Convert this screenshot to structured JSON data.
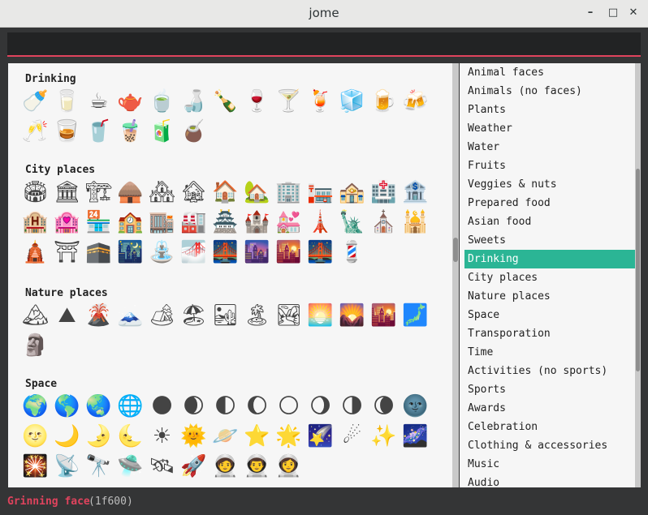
{
  "window": {
    "title": "jome",
    "minimize_glyph": "–",
    "maximize_glyph": "□",
    "close_glyph": "✕"
  },
  "search": {
    "value": ""
  },
  "sections": [
    {
      "title": "Drinking",
      "emojis": [
        "🍼",
        "🥛",
        "☕",
        "🫖",
        "🍵",
        "🍶",
        "🍾",
        "🍷",
        "🍸",
        "🍹",
        "🧊",
        "🍺",
        "🍻",
        "🥂",
        "🥃",
        "🥤",
        "🧋",
        "🧃",
        "🧉"
      ]
    },
    {
      "title": "City places",
      "emojis": [
        "🏟",
        "🏛",
        "🏗",
        "🛖",
        "🏘",
        "🏚",
        "🏠",
        "🏡",
        "🏢",
        "🏣",
        "🏤",
        "🏥",
        "🏦",
        "🏨",
        "🏩",
        "🏪",
        "🏫",
        "🏬",
        "🏭",
        "🏯",
        "🏰",
        "💒",
        "🗼",
        "🗽",
        "⛪",
        "🕌",
        "🛕",
        "⛩",
        "🕋",
        "🌃",
        "⛲",
        "🌁",
        "🌉",
        "🌆",
        "🌇",
        "🌉",
        "💈"
      ]
    },
    {
      "title": "Nature places",
      "emojis": [
        "🏔",
        "⛰",
        "🌋",
        "🗻",
        "🏕",
        "🏖",
        "🏜",
        "🏝",
        "🏞",
        "🌅",
        "🌄",
        "🌇",
        "🗾",
        "🗿"
      ]
    },
    {
      "title": "Space",
      "emojis": [
        "🌍",
        "🌎",
        "🌏",
        "🌐",
        "🌑",
        "🌒",
        "🌓",
        "🌔",
        "🌕",
        "🌖",
        "🌗",
        "🌘",
        "🌚",
        "🌝",
        "🌙",
        "🌛",
        "🌜",
        "☀",
        "🌞",
        "🪐",
        "⭐",
        "🌟",
        "🌠",
        "☄",
        "✨",
        "🌌",
        "🎇",
        "📡",
        "🔭",
        "🛸",
        "🛰",
        "🚀",
        "🧑‍🚀",
        "👨‍🚀",
        "👩‍🚀"
      ]
    }
  ],
  "categories": [
    "Animal faces",
    "Animals (no faces)",
    "Plants",
    "Weather",
    "Water",
    "Fruits",
    "Veggies & nuts",
    "Prepared food",
    "Asian food",
    "Sweets",
    "Drinking",
    "City places",
    "Nature places",
    "Space",
    "Transporation",
    "Time",
    "Activities (no sports)",
    "Sports",
    "Awards",
    "Celebration",
    "Clothing & accessories",
    "Music",
    "Audio"
  ],
  "selected_category": "Drinking",
  "status": {
    "name": "Grinning face",
    "code": "(1f600)"
  },
  "colors": {
    "accent": "#e0435d",
    "selected": "#2bb595",
    "background": "#343536",
    "panel": "#f6f6f6"
  }
}
